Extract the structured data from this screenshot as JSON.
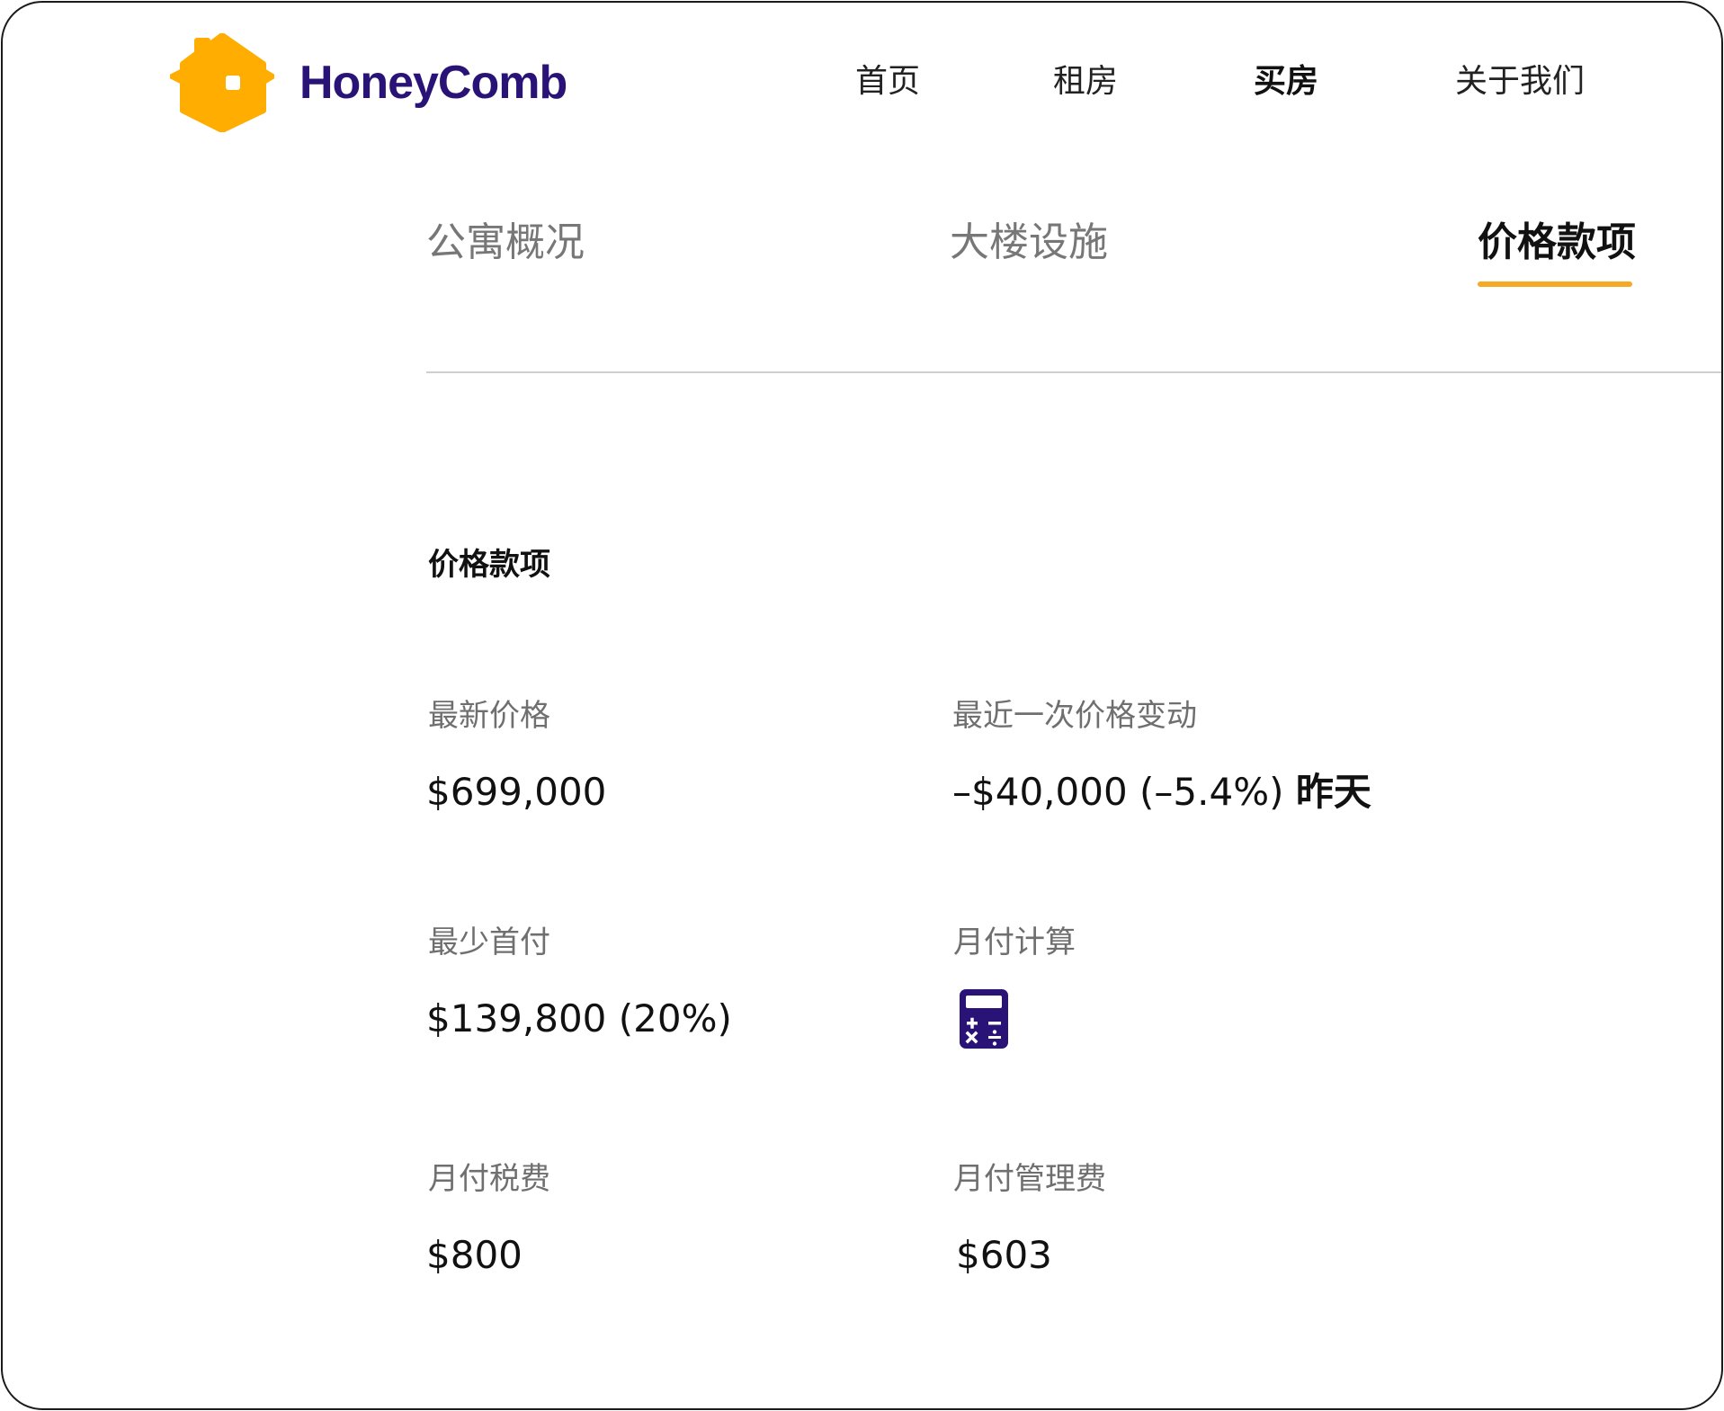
{
  "brand": {
    "name": "HoneyComb",
    "logo_icon": "house-hexagon-icon",
    "logo_color": "#FFAD00",
    "text_color": "#2A1377"
  },
  "nav": {
    "items": [
      {
        "label": "首页",
        "active": false
      },
      {
        "label": "租房",
        "active": false
      },
      {
        "label": "买房",
        "active": true
      },
      {
        "label": "关于我们",
        "active": false
      }
    ]
  },
  "tabs": {
    "items": [
      {
        "label": "公寓概况",
        "active": false
      },
      {
        "label": "大楼设施",
        "active": false
      },
      {
        "label": "价格款项",
        "active": true
      }
    ],
    "accent_color": "#F6A925"
  },
  "pricing": {
    "title": "价格款项",
    "latest_price": {
      "label": "最新价格",
      "value": "$699,000"
    },
    "recent_change": {
      "label": "最近一次价格变动",
      "value": "–$40,000 (–5.4%)",
      "when": "昨天"
    },
    "min_down_payment": {
      "label": "最少首付",
      "value": "$139,800 (20%)"
    },
    "monthly_calc": {
      "label": "月付计算",
      "icon": "calculator-icon",
      "icon_color": "#2A1377"
    },
    "monthly_tax": {
      "label": "月付税费",
      "value": "$800"
    },
    "monthly_mgmt_fee": {
      "label": "月付管理费",
      "value": "$603"
    }
  }
}
